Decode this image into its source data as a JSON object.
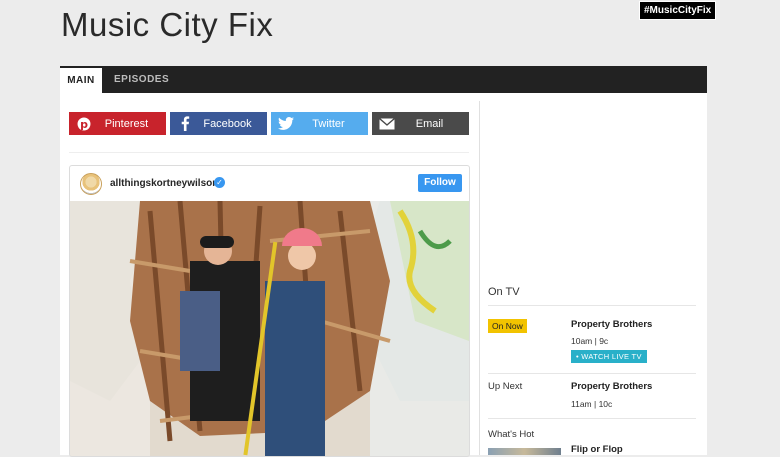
{
  "page": {
    "title": "Music City Fix",
    "hashtag": "#MusicCityFix"
  },
  "tabs": [
    {
      "label": "MAIN",
      "active": true
    },
    {
      "label": "EPISODES",
      "active": false
    }
  ],
  "share": {
    "pinterest": {
      "label": "Pinterest",
      "icon": "pinterest-icon",
      "color": "#c8232c"
    },
    "facebook": {
      "label": "Facebook",
      "icon": "facebook-icon",
      "color": "#3b5998"
    },
    "twitter": {
      "label": "Twitter",
      "icon": "twitter-icon",
      "color": "#55acee"
    },
    "email": {
      "label": "Email",
      "icon": "envelope-icon",
      "color": "#4a4a4a"
    }
  },
  "instagram": {
    "username": "allthingskortneywilson",
    "verified_mark": "✓",
    "follow_label": "Follow"
  },
  "tv": {
    "section_label": "On TV",
    "on_now": {
      "badge": "On Now",
      "show": "Property Brothers",
      "time": "10am | 9c",
      "watch_label": "• WATCH LIVE TV"
    },
    "up_next": {
      "label": "Up Next",
      "show": "Property Brothers",
      "time": "11am | 10c"
    },
    "whats_hot": {
      "label": "What's Hot",
      "show": "Flip or Flop"
    }
  },
  "colors": {
    "on_now_badge": "#f2c300",
    "watch_button": "#29b0c9",
    "follow_button": "#3897f0"
  }
}
